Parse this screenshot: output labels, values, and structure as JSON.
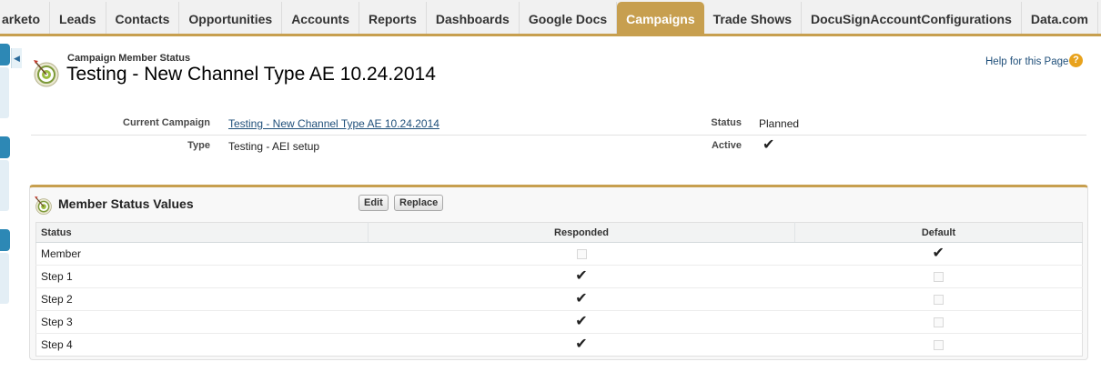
{
  "tabs": [
    {
      "label": "arketo",
      "active": false
    },
    {
      "label": "Leads",
      "active": false
    },
    {
      "label": "Contacts",
      "active": false
    },
    {
      "label": "Opportunities",
      "active": false
    },
    {
      "label": "Accounts",
      "active": false
    },
    {
      "label": "Reports",
      "active": false
    },
    {
      "label": "Dashboards",
      "active": false
    },
    {
      "label": "Google Docs",
      "active": false
    },
    {
      "label": "Campaigns",
      "active": true
    },
    {
      "label": "Trade Shows",
      "active": false
    },
    {
      "label": "DocuSignAccountConfigurations",
      "active": false
    },
    {
      "label": "Data.com",
      "active": false
    }
  ],
  "tab_icons": {
    "add": "+",
    "more": "▼"
  },
  "header": {
    "subtitle": "Campaign Member Status",
    "title": "Testing - New Channel Type AE 10.24.2014",
    "help_link": "Help for this Page",
    "help_icon": "?"
  },
  "detail": {
    "current_campaign_label": "Current Campaign",
    "current_campaign_value": "Testing - New Channel Type AE 10.24.2014",
    "type_label": "Type",
    "type_value": "Testing - AEI setup",
    "status_label": "Status",
    "status_value": "Planned",
    "active_label": "Active",
    "active_checked": true
  },
  "related_list": {
    "title": "Member Status Values",
    "edit_button": "Edit",
    "replace_button": "Replace",
    "columns": {
      "status": "Status",
      "responded": "Responded",
      "default": "Default"
    },
    "rows": [
      {
        "status": "Member",
        "responded": false,
        "default": true
      },
      {
        "status": "Step 1",
        "responded": true,
        "default": false
      },
      {
        "status": "Step 2",
        "responded": true,
        "default": false
      },
      {
        "status": "Step 3",
        "responded": true,
        "default": false
      },
      {
        "status": "Step 4",
        "responded": true,
        "default": false
      }
    ]
  },
  "colors": {
    "accent": "#c79f4f",
    "link": "#1f4f7a",
    "sidebar_tab": "#2d88b5",
    "help": "#e8a21c"
  }
}
